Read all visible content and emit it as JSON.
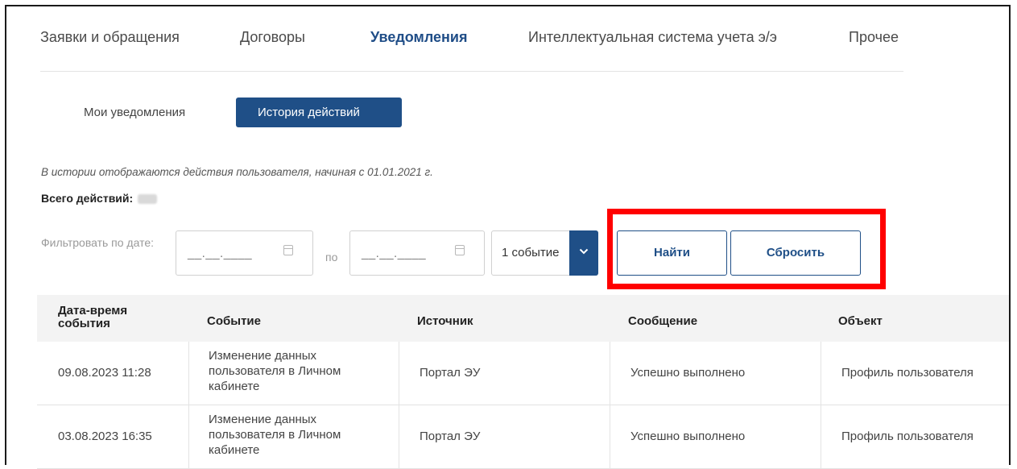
{
  "nav": {
    "items": [
      {
        "label": "Заявки и обращения",
        "active": false
      },
      {
        "label": "Договоры",
        "active": false
      },
      {
        "label": "Уведомления",
        "active": true
      },
      {
        "label": "Интеллектуальная система учета э/э",
        "active": false
      },
      {
        "label": "Прочее",
        "active": false
      }
    ]
  },
  "subtabs": [
    {
      "label": "Мои уведомления",
      "active": false
    },
    {
      "label": "История действий",
      "active": true
    }
  ],
  "info_text": "В истории отображаются действия пользователя, начиная с 01.01.2021 г.",
  "total_label": "Всего действий:",
  "filter": {
    "label": "Фильтровать по дате:",
    "date_from_placeholder": "__.__.____",
    "between_label": "по",
    "date_to_placeholder": "__.__.____",
    "event_select_value": "1 событие",
    "find_button": "Найти",
    "reset_button": "Сбросить"
  },
  "table": {
    "headers": [
      "Дата-время события",
      "Событие",
      "Источник",
      "Сообщение",
      "Объект"
    ],
    "rows": [
      {
        "datetime": "09.08.2023 11:28",
        "event": "Изменение данных пользователя в Личном кабинете",
        "source": "Портал ЭУ",
        "message": "Успешно выполнено",
        "object": "Профиль пользователя"
      },
      {
        "datetime": "03.08.2023 16:35",
        "event": "Изменение данных пользователя в Личном кабинете",
        "source": "Портал ЭУ",
        "message": "Успешно выполнено",
        "object": "Профиль пользователя"
      }
    ]
  },
  "colors": {
    "accent": "#1f4f87",
    "highlight": "#ff0000"
  },
  "icons": {
    "calendar": "calendar-icon",
    "dropdown": "chevron-down-icon"
  }
}
